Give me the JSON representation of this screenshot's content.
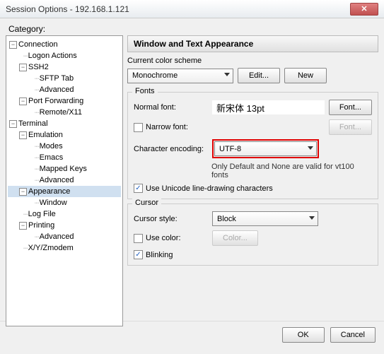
{
  "titlebar": {
    "title": "Session Options - 192.168.1.121"
  },
  "category_label": "Category:",
  "tree": {
    "connection": "Connection",
    "logon_actions": "Logon Actions",
    "ssh2": "SSH2",
    "sftp_tab": "SFTP Tab",
    "advanced1": "Advanced",
    "port_forwarding": "Port Forwarding",
    "remote_x11": "Remote/X11",
    "terminal": "Terminal",
    "emulation": "Emulation",
    "modes": "Modes",
    "emacs": "Emacs",
    "mapped_keys": "Mapped Keys",
    "advanced2": "Advanced",
    "appearance": "Appearance",
    "window": "Window",
    "log_file": "Log File",
    "printing": "Printing",
    "advanced3": "Advanced",
    "xyzmodem": "X/Y/Zmodem"
  },
  "panel": {
    "header": "Window and Text Appearance",
    "color_scheme": {
      "label": "Current color scheme",
      "value": "Monochrome",
      "edit_btn": "Edit...",
      "new_btn": "New"
    },
    "fonts": {
      "group": "Fonts",
      "normal_label": "Normal font:",
      "normal_value": "新宋体 13pt",
      "font_btn": "Font...",
      "narrow_label": "Narrow font:",
      "encoding_label": "Character encoding:",
      "encoding_value": "UTF-8",
      "hint": "Only Default and None are valid for vt100 fonts",
      "unicode_lines": "Use Unicode line-drawing characters"
    },
    "cursor": {
      "group": "Cursor",
      "style_label": "Cursor style:",
      "style_value": "Block",
      "use_color_label": "Use color:",
      "color_btn": "Color...",
      "blinking_label": "Blinking"
    }
  },
  "footer": {
    "ok": "OK",
    "cancel": "Cancel"
  }
}
